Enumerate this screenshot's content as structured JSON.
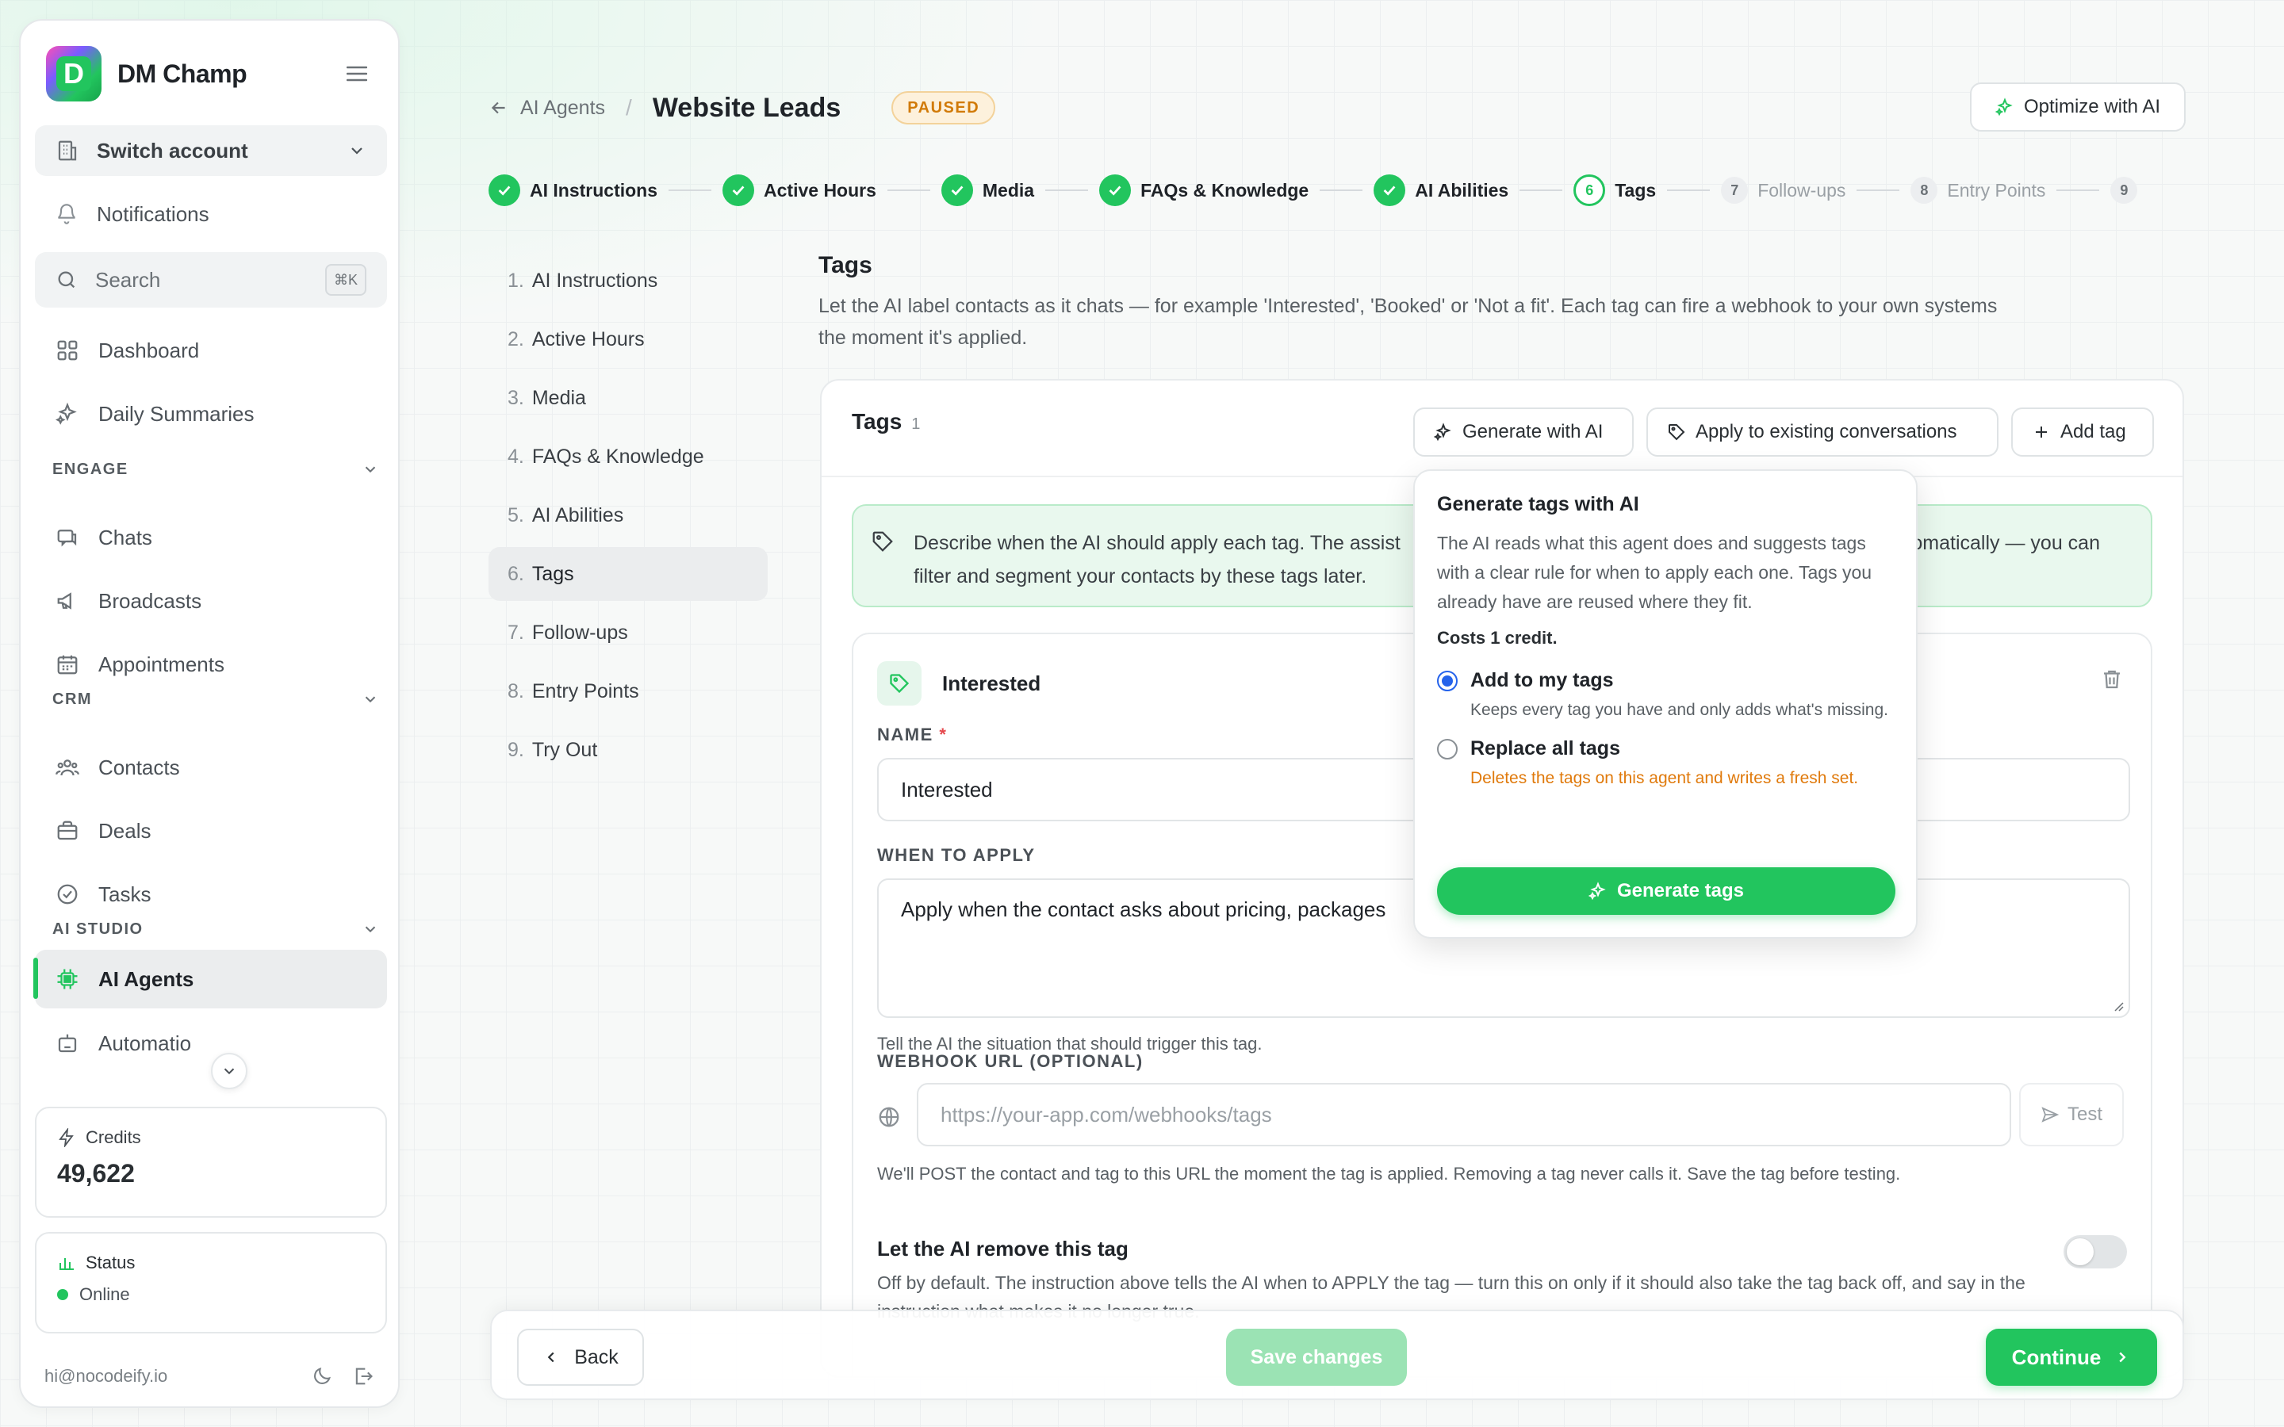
{
  "app": {
    "brand": "DM Champ"
  },
  "sidebar": {
    "switch_account": "Switch account",
    "notifications": "Notifications",
    "search": "Search",
    "search_shortcut": "⌘K",
    "dashboard": "Dashboard",
    "daily_summaries": "Daily Summaries",
    "sections": {
      "engage": "ENGAGE",
      "crm": "CRM",
      "ai_studio": "AI STUDIO"
    },
    "engage_items": [
      "Chats",
      "Broadcasts",
      "Appointments"
    ],
    "crm_items": [
      "Contacts",
      "Deals",
      "Tasks"
    ],
    "ai_items": [
      "AI Agents",
      "Automatio"
    ],
    "credits_label": "Credits",
    "credits_value": "49,622",
    "status_label": "Status",
    "status_value": "Online",
    "email": "hi@nocodeify.io"
  },
  "header": {
    "breadcrumb": "AI Agents",
    "title": "Website Leads",
    "badge": "PAUSED",
    "optimize": "Optimize with AI"
  },
  "stepper": [
    {
      "label": "AI Instructions",
      "state": "done"
    },
    {
      "label": "Active Hours",
      "state": "done"
    },
    {
      "label": "Media",
      "state": "done"
    },
    {
      "label": "FAQs & Knowledge",
      "state": "done"
    },
    {
      "label": "AI Abilities",
      "state": "done"
    },
    {
      "label": "Tags",
      "state": "current",
      "num": "6"
    },
    {
      "label": "Follow-ups",
      "state": "future",
      "num": "7"
    },
    {
      "label": "Entry Points",
      "state": "future",
      "num": "8"
    },
    {
      "label": "",
      "state": "future",
      "num": "9"
    }
  ],
  "steplist": [
    {
      "n": "1.",
      "label": "AI Instructions"
    },
    {
      "n": "2.",
      "label": "Active Hours"
    },
    {
      "n": "3.",
      "label": "Media"
    },
    {
      "n": "4.",
      "label": "FAQs & Knowledge"
    },
    {
      "n": "5.",
      "label": "AI Abilities"
    },
    {
      "n": "6.",
      "label": "Tags"
    },
    {
      "n": "7.",
      "label": "Follow-ups"
    },
    {
      "n": "8.",
      "label": "Entry Points"
    },
    {
      "n": "9.",
      "label": "Try Out"
    }
  ],
  "section": {
    "title": "Tags",
    "desc": "Let the AI label contacts as it chats — for example 'Interested', 'Booked' or 'Not a fit'. Each tag can fire a webhook to your own systems the moment it's applied."
  },
  "panel": {
    "title": "Tags",
    "count": "1",
    "generate": "Generate with AI",
    "apply": "Apply to existing conversations",
    "add": "Add tag",
    "info_line1": "Describe when the AI should apply each tag. The assist",
    "info_line1_end": "omatically — you can",
    "info_line2": "filter and segment your contacts by these tags later."
  },
  "tag": {
    "name": "Interested",
    "name_label": "NAME",
    "name_req": "*",
    "name_value": "Interested",
    "when_label": "WHEN TO APPLY",
    "when_value": "Apply when the contact asks about pricing, packages",
    "when_hint": "Tell the AI the situation that should trigger this tag.",
    "webhook_label": "WEBHOOK URL (OPTIONAL)",
    "webhook_placeholder": "https://your-app.com/webhooks/tags",
    "test": "Test",
    "webhook_hint": "We'll POST the contact and tag to this URL the moment the tag is applied. Removing a tag never calls it. Save the tag before testing.",
    "remove_title": "Let the AI remove this tag",
    "remove_desc": "Off by default. The instruction above tells the AI when to APPLY the tag — turn this on only if it should also take the tag back off, and say in the instruction what makes it no longer true."
  },
  "popover": {
    "title": "Generate tags with AI",
    "desc": "The AI reads what this agent does and suggests tags with a clear rule for when to apply each one. Tags you already have are reused where they fit.",
    "cost": "Costs 1 credit.",
    "opt1_title": "Add to my tags",
    "opt1_sub": "Keeps every tag you have and only adds what's missing.",
    "opt2_title": "Replace all tags",
    "opt2_sub": "Deletes the tags on this agent and writes a fresh set.",
    "button": "Generate tags"
  },
  "actions": {
    "back": "Back",
    "save": "Save changes",
    "continue": "Continue"
  },
  "colors": {
    "accent": "#22c55e",
    "warning": "#d17a08",
    "radio": "#2563eb"
  }
}
